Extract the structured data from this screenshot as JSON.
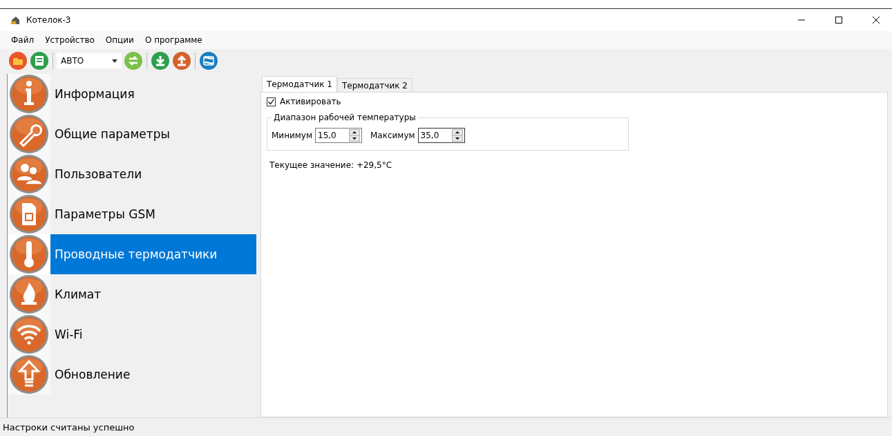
{
  "window": {
    "title": "Котелок-3"
  },
  "menu": [
    "Файл",
    "Устройство",
    "Опции",
    "О программе"
  ],
  "toolbar": {
    "mode": "АВТО"
  },
  "sidebar": {
    "items": [
      {
        "label": "Информация",
        "selected": false
      },
      {
        "label": "Общие параметры",
        "selected": false
      },
      {
        "label": "Пользователи",
        "selected": false
      },
      {
        "label": "Параметры GSM",
        "selected": false
      },
      {
        "label": "Проводные термодатчики",
        "selected": true
      },
      {
        "label": "Климат",
        "selected": false
      },
      {
        "label": "Wi-Fi",
        "selected": false
      },
      {
        "label": "Обновление",
        "selected": false
      }
    ]
  },
  "tabs": [
    {
      "label": "Термодатчик 1",
      "selected": true
    },
    {
      "label": "Термодатчик 2",
      "selected": false
    }
  ],
  "activate": {
    "label": "Активировать",
    "checked": true
  },
  "range": {
    "title": "Диапазон рабочей температуры",
    "min_label": "Минимум",
    "min_value": "15,0",
    "max_label": "Максимум",
    "max_value": "35,0"
  },
  "current": "Текущее значение: +29,5°C",
  "status_bar": "Настроки считаны успешно"
}
